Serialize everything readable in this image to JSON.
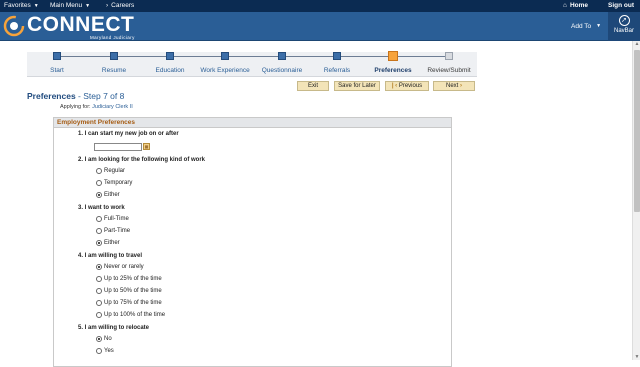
{
  "topbar": {
    "favorites": "Favorites",
    "main_menu": "Main Menu",
    "breadcrumb_sep": "›",
    "breadcrumb": "Careers",
    "home": "Home",
    "signout": "Sign out"
  },
  "brand": {
    "name": "CONNECT",
    "subtitle": "Maryland Judiciary",
    "add_to": "Add To",
    "navbar": "NavBar"
  },
  "train": {
    "stops": [
      {
        "label": "Start",
        "state": "done"
      },
      {
        "label": "Resume",
        "state": "done"
      },
      {
        "label": "Education",
        "state": "done"
      },
      {
        "label": "Work Experience",
        "state": "done"
      },
      {
        "label": "Questionnaire",
        "state": "done"
      },
      {
        "label": "Referrals",
        "state": "done"
      },
      {
        "label": "Preferences",
        "state": "current"
      },
      {
        "label": "Review/Submit",
        "state": "pending"
      }
    ]
  },
  "actions": {
    "exit": "Exit",
    "save_for_later": "Save for Later",
    "previous": "Previous",
    "next": "Next"
  },
  "page": {
    "title": "Preferences",
    "step": " - Step 7 of 8",
    "applying_label": "Applying for:",
    "applying_job": "Judiciary Clerk II"
  },
  "panel": {
    "header": "Employment Preferences",
    "q1": "1. I can start my new job on or after",
    "q1_value": "",
    "q2": "2. I am looking for the following kind of work",
    "q2_options": [
      "Regular",
      "Temporary",
      "Either"
    ],
    "q2_selected": "Either",
    "q3": "3. I want to work",
    "q3_options": [
      "Full-Time",
      "Part-Time",
      "Either"
    ],
    "q3_selected": "Either",
    "q4": "4. I am willing to travel",
    "q4_options": [
      "Never or rarely",
      "Up to 25% of the time",
      "Up to 50% of the time",
      "Up to 75% of the time",
      "Up to 100% of the time"
    ],
    "q4_selected": "Never or rarely",
    "q5": "5. I am willing to relocate",
    "q5_options": [
      "No",
      "Yes"
    ],
    "q5_selected": "No"
  }
}
